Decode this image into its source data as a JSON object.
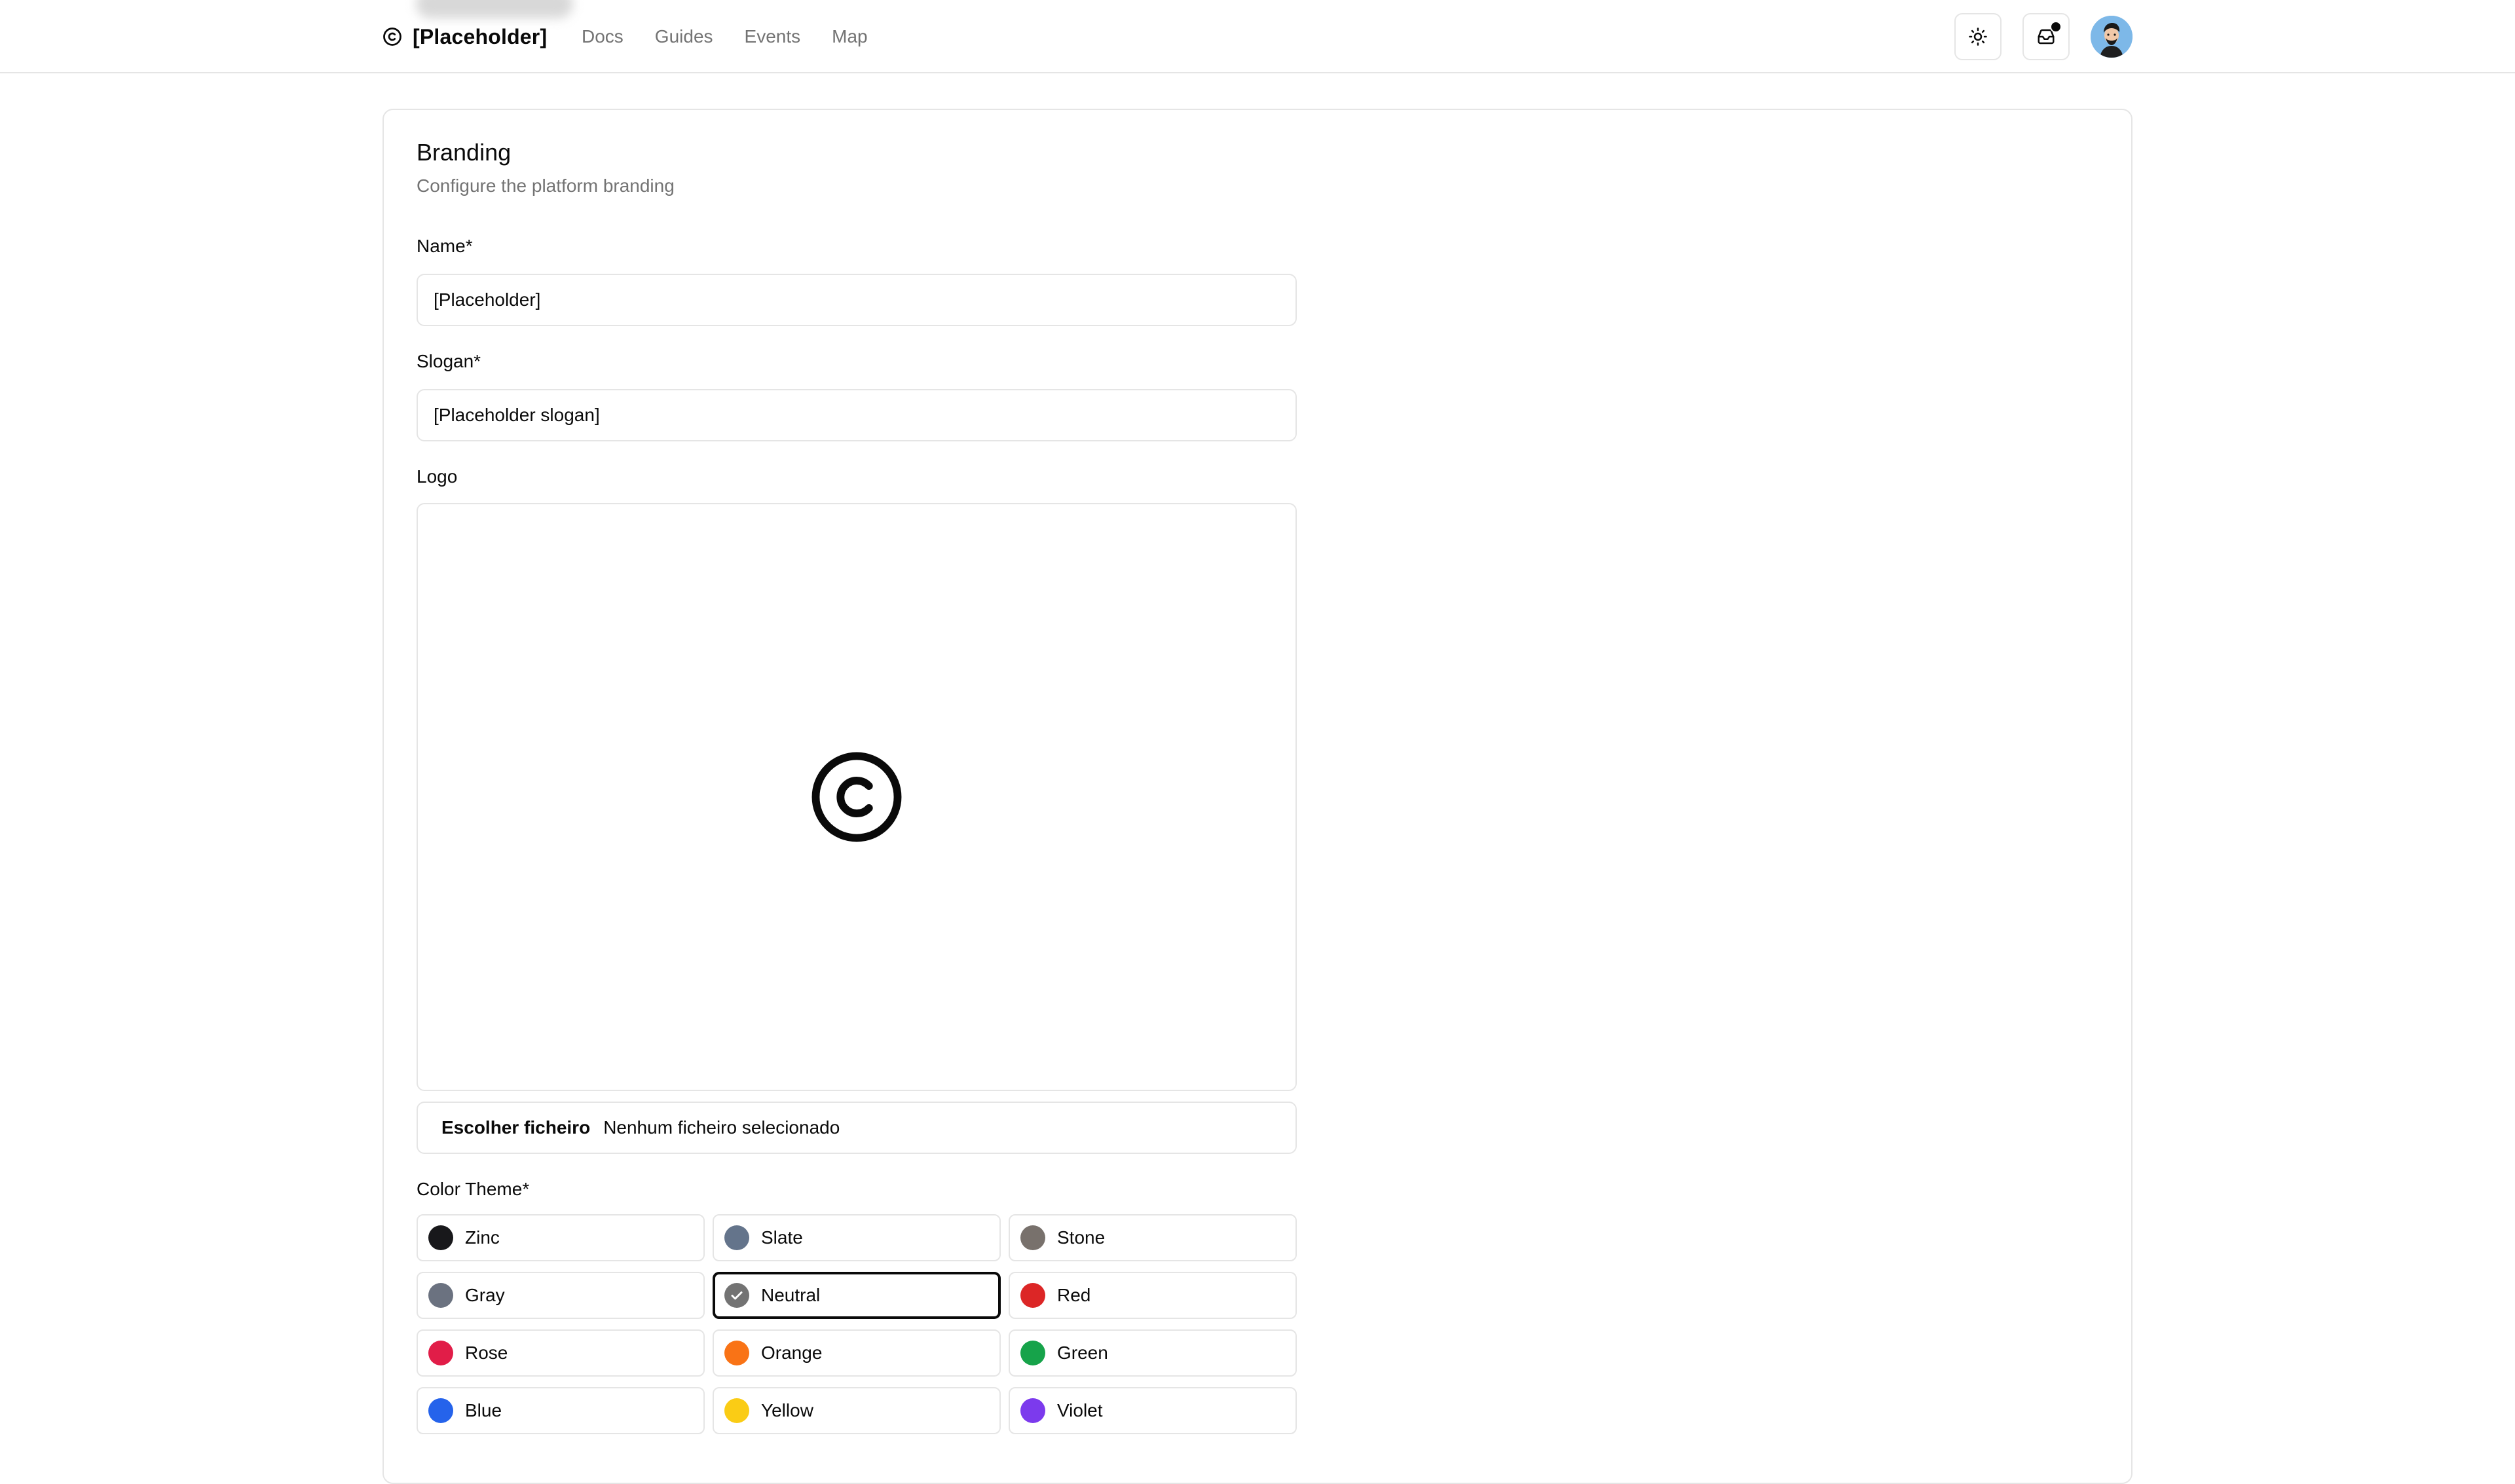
{
  "header": {
    "brand_name": "[Placeholder]",
    "brand_icon": "copyright-icon",
    "nav": [
      {
        "label": "Docs"
      },
      {
        "label": "Guides"
      },
      {
        "label": "Events"
      },
      {
        "label": "Map"
      }
    ],
    "theme_toggle_icon": "sun-icon",
    "inbox_icon": "inbox-icon",
    "has_notification": true
  },
  "branding": {
    "title": "Branding",
    "description": "Configure the platform branding",
    "name_label": "Name*",
    "name_value": "[Placeholder]",
    "slogan_label": "Slogan*",
    "slogan_value": "[Placeholder slogan]",
    "logo_label": "Logo",
    "logo_preview_icon": "copyright-icon",
    "file_button_label": "Escolher ficheiro",
    "file_status": "Nenhum ficheiro selecionado",
    "color_theme_label": "Color Theme*",
    "color_themes": [
      {
        "name": "Zinc",
        "color": "#18181b",
        "selected": false
      },
      {
        "name": "Slate",
        "color": "#64748b",
        "selected": false
      },
      {
        "name": "Stone",
        "color": "#78716c",
        "selected": false
      },
      {
        "name": "Gray",
        "color": "#6b7280",
        "selected": false
      },
      {
        "name": "Neutral",
        "color": "#737373",
        "selected": true
      },
      {
        "name": "Red",
        "color": "#dc2626",
        "selected": false
      },
      {
        "name": "Rose",
        "color": "#e11d48",
        "selected": false
      },
      {
        "name": "Orange",
        "color": "#f97316",
        "selected": false
      },
      {
        "name": "Green",
        "color": "#16a34a",
        "selected": false
      },
      {
        "name": "Blue",
        "color": "#2563eb",
        "selected": false
      },
      {
        "name": "Yellow",
        "color": "#facc15",
        "selected": false
      },
      {
        "name": "Violet",
        "color": "#7c3aed",
        "selected": false
      }
    ]
  }
}
